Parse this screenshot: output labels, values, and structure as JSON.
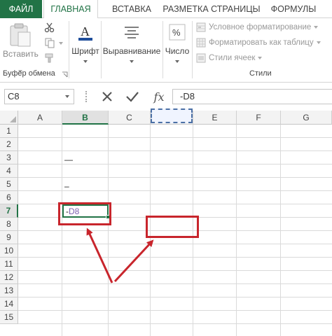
{
  "tabs": {
    "file": "ФАЙЛ",
    "home": "ГЛАВНАЯ",
    "insert": "ВСТАВКА",
    "page_layout": "РАЗМЕТКА СТРАНИЦЫ",
    "formulas": "ФОРМУЛЫ"
  },
  "ribbon": {
    "clipboard": {
      "paste_label": "Вставить",
      "group_label": "Буфер обмена"
    },
    "font_label": "Шрифт",
    "alignment_label": "Выравнивание",
    "number_label": "Число",
    "styles": {
      "conditional_formatting": "Условное форматирование",
      "format_as_table": "Форматировать как таблицу",
      "cell_styles": "Стили ячеек",
      "group_label": "Стили"
    }
  },
  "formula_bar": {
    "name_box": "C8",
    "formula": "-D8",
    "fx_symbol": "fx"
  },
  "grid": {
    "columns": [
      "A",
      "B",
      "C",
      "D",
      "E",
      "F",
      "G"
    ],
    "rows": [
      "1",
      "2",
      "3",
      "4",
      "5",
      "6",
      "7",
      "8",
      "9",
      "10",
      "11",
      "12",
      "13",
      "14",
      "15"
    ],
    "selected_column": "B",
    "selected_row": "7",
    "cells": {
      "B3": "—",
      "B5": "–",
      "B7_prefix": "-",
      "B7_ref": "D8"
    }
  },
  "colors": {
    "accent": "#217346",
    "highlight_red": "#c8252c"
  }
}
